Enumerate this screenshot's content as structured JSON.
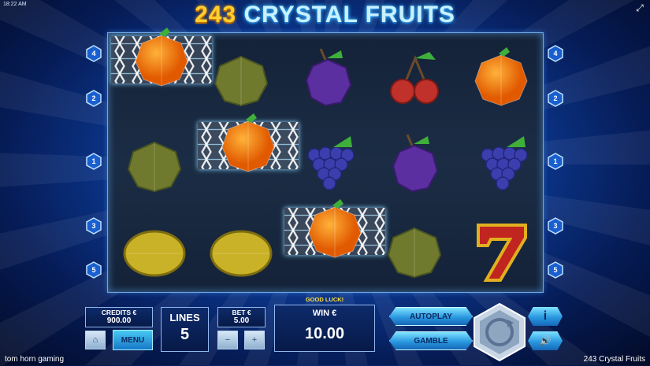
{
  "status": {
    "clock": "18:22 AM"
  },
  "title": {
    "number": "243",
    "text": "CRYSTAL FRUITS"
  },
  "paylines": {
    "left": [
      "4",
      "2",
      "1",
      "3",
      "5"
    ],
    "right": [
      "4",
      "2",
      "1",
      "3",
      "5"
    ]
  },
  "reels": [
    [
      "orange",
      "kiwi",
      "lemon"
    ],
    [
      "kiwi",
      "orange",
      "lemon"
    ],
    [
      "plum",
      "grapes",
      "orange"
    ],
    [
      "cherries",
      "plum",
      "kiwi"
    ],
    [
      "orange",
      "grapes",
      "seven"
    ]
  ],
  "winning_cells": [
    [
      0,
      0
    ],
    [
      1,
      1
    ],
    [
      2,
      2
    ]
  ],
  "credits": {
    "label": "CREDITS €",
    "value": "900.00"
  },
  "menu_label": "MENU",
  "lines": {
    "label": "LINES",
    "value": "5"
  },
  "bet": {
    "label": "BET €",
    "value": "5.00"
  },
  "message": "GOOD LUCK!",
  "win": {
    "label": "WIN €",
    "value": "10.00"
  },
  "autoplay_label": "AUTOPLAY",
  "gamble_label": "GAMBLE",
  "info_label": "i",
  "footer": {
    "brand": "tom horn gaming",
    "game_name": "243 Crystal Fruits"
  },
  "colors": {
    "accent_yellow": "#ffe23a",
    "button_cyan": "#2a98e0",
    "title_blue": "#c9f1ff"
  },
  "icons": [
    "fullscreen-icon",
    "house-icon",
    "minus-icon",
    "plus-icon",
    "spin-icon",
    "sound-icon"
  ]
}
